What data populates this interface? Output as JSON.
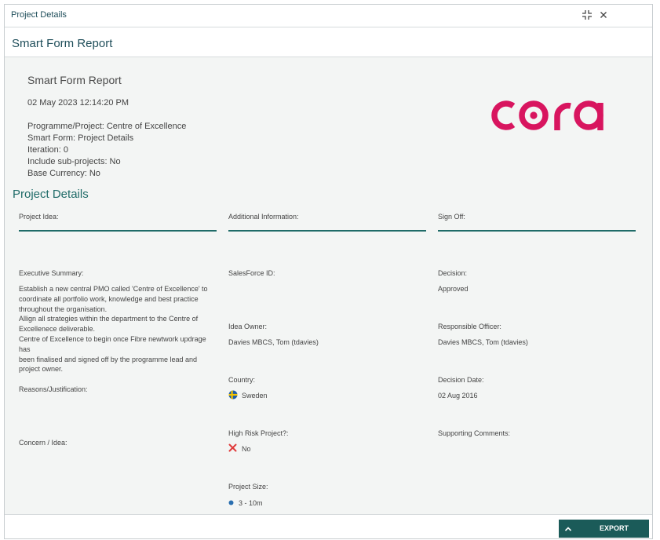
{
  "window": {
    "title": "Project Details"
  },
  "header": {
    "title": "Smart Form Report"
  },
  "report": {
    "title": "Smart Form Report",
    "generated": "02 May 2023 12:14:20 PM",
    "meta": [
      "Programme/Project: Centre of Excellence",
      "Smart Form: Project Details",
      "Iteration: 0",
      "Include sub-projects: No",
      "Base Currency: No"
    ],
    "logo_text": "cora",
    "logo_color": "#d8155f"
  },
  "section": {
    "title": "Project Details"
  },
  "columns": [
    "Project Idea:",
    "Additional Information:",
    "Sign Off:"
  ],
  "fields": {
    "exec_summary_label": "Executive Summary:",
    "exec_summary_lines": [
      "Establish a new central PMO called 'Centre of Excellence' to",
      "coordinate all portfolio work, knowledge and best practice",
      "throughout the organisation.",
      "Allign all strategies within the department  to the Centre of",
      "Excellenece deliverable.",
      "Centre of Excellence to begin once Fibre newtwork updrage has",
      "been finalised and signed off by the programme lead and",
      "project owner."
    ],
    "reasons_label": "Reasons/Justification:",
    "concern_label": "Concern / Idea:",
    "salesforce_label": "SalesForce ID:",
    "idea_owner_label": "Idea Owner:",
    "idea_owner_value": "Davies MBCS, Tom (tdavies)",
    "country_label": "Country:",
    "country_value": "Sweden",
    "high_risk_label": "High Risk Project?:",
    "high_risk_value": "No",
    "project_size_label": "Project Size:",
    "project_size_value": "3 - 10m",
    "decision_label": "Decision:",
    "decision_value": "Approved",
    "resp_officer_label": "Responsible Officer:",
    "resp_officer_value": "Davies MBCS, Tom (tdavies)",
    "decision_date_label": "Decision Date:",
    "decision_date_value": "02 Aug 2016",
    "supporting_label": "Supporting Comments:"
  },
  "footer": {
    "export_label": "EXPORT"
  },
  "colors": {
    "accent": "#1f6b68",
    "export_bg": "#1b5b59",
    "no_icon": "#e03c3c",
    "size_dot": "#2a6fb0"
  }
}
